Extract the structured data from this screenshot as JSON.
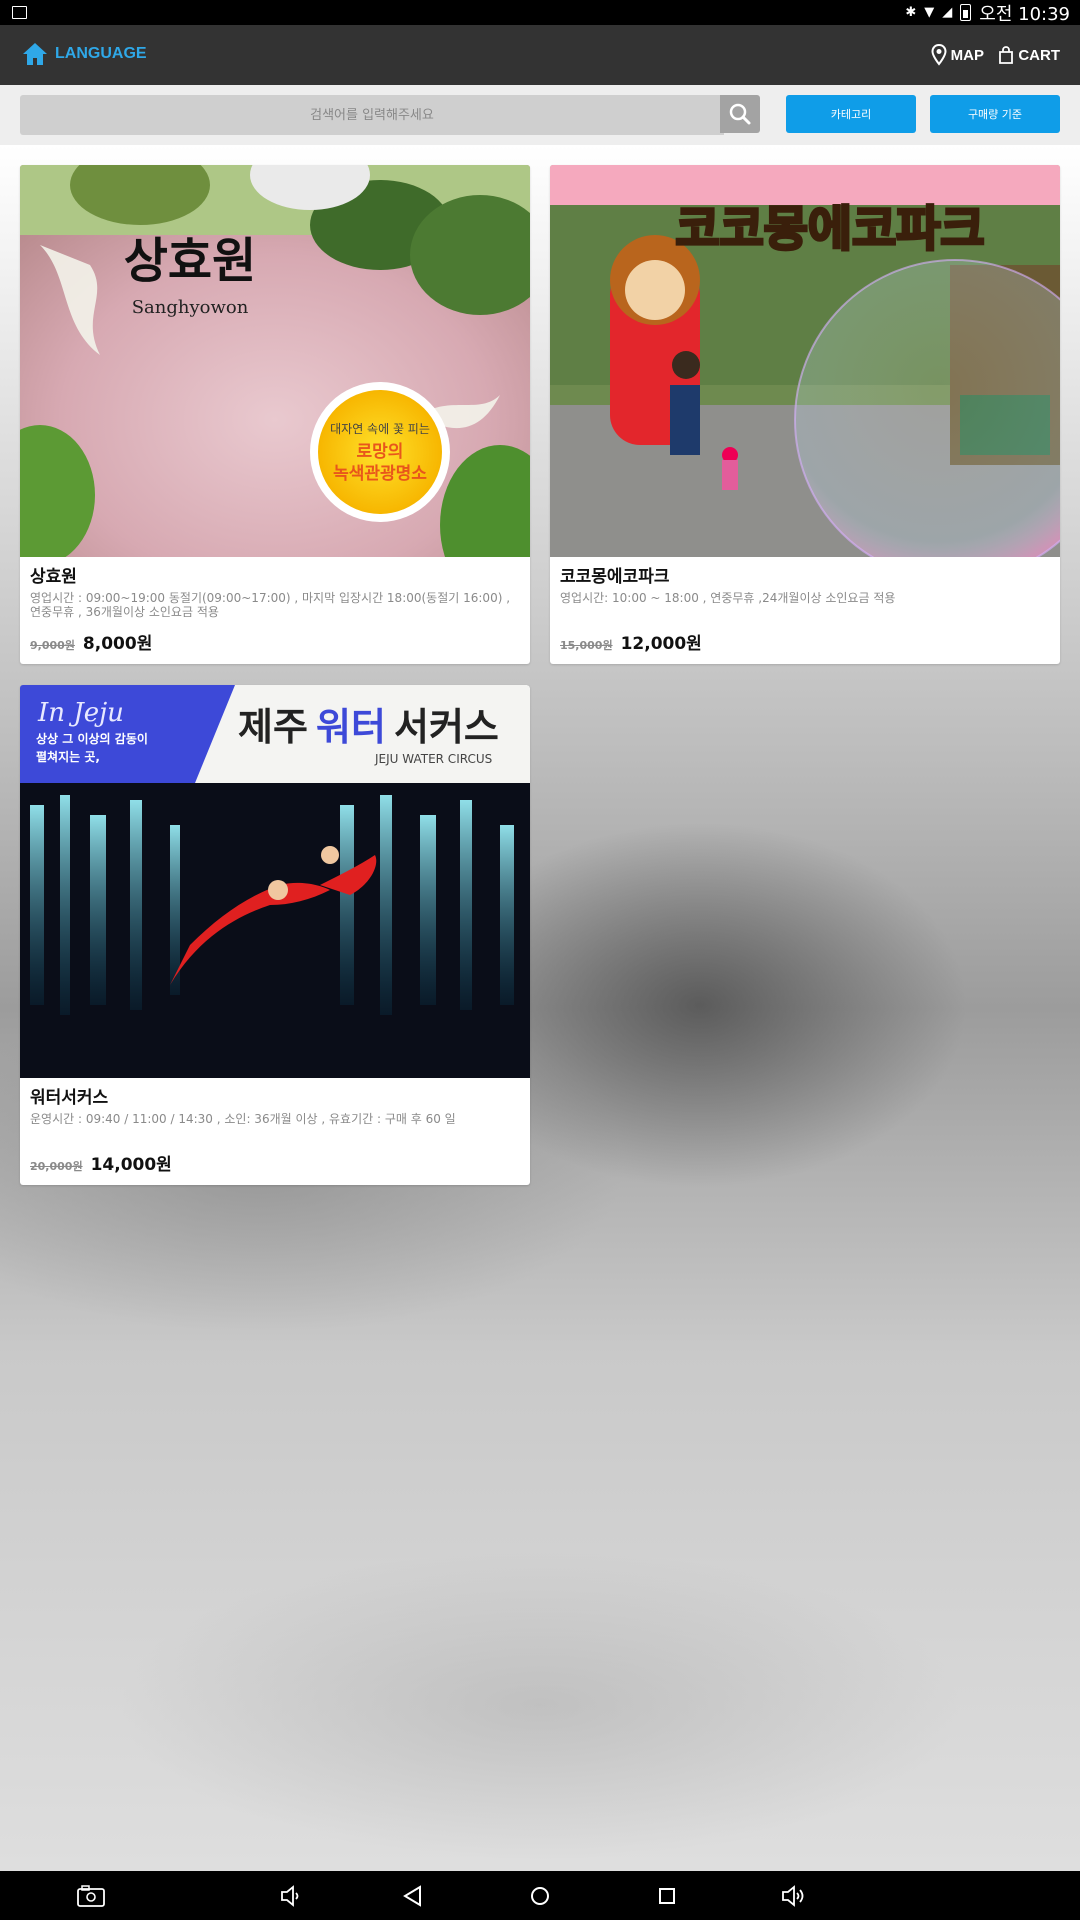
{
  "status_bar": {
    "time": "오전 10:39"
  },
  "app_bar": {
    "language_label": "LANGUAGE",
    "map_label": "MAP",
    "cart_label": "CART",
    "accent_color": "#2fa8e8"
  },
  "search": {
    "placeholder": "검색어를 입력해주세요",
    "category_button": "카테고리",
    "sort_button": "구매량 기준",
    "button_color": "#0f9de8"
  },
  "products": [
    {
      "image_title": "상효원",
      "image_subtitle": "Sanghyowon",
      "image_badge_line1": "대자연 속에 꽃 피는",
      "image_badge_line2": "로망의",
      "image_badge_line3": "녹색관광명소",
      "name": "상효원",
      "description": "영업시간 : 09:00~19:00 동절기(09:00~17:00) , 마지막 입장시간 18:00(동절기 16:00) , 연중무휴 , 36개월이상 소인요금 적용",
      "original_price": "9,000원",
      "price": "8,000원"
    },
    {
      "image_title": "코코몽에코파크",
      "name": "코코몽에코파크",
      "description": "영업시간: 10:00 ~ 18:00 , 연중무휴 ,24개월이상 소인요금 적용",
      "original_price": "15,000원",
      "price": "12,000원"
    },
    {
      "image_tag": "In Jeju",
      "image_tagline1": "상상 그 이상의 감동이",
      "image_tagline2": "펼쳐지는 곳,",
      "image_title_a": "제주",
      "image_title_b": "워터",
      "image_title_c": "서커스",
      "image_subtitle": "JEJU WATER CIRCUS",
      "name": "워터서커스",
      "description": "운영시간 : 09:40 / 11:00 / 14:30 , 소인: 36개월 이상 , 유효기간 : 구매 후 60 일",
      "original_price": "20,000원",
      "price": "14,000원"
    }
  ]
}
